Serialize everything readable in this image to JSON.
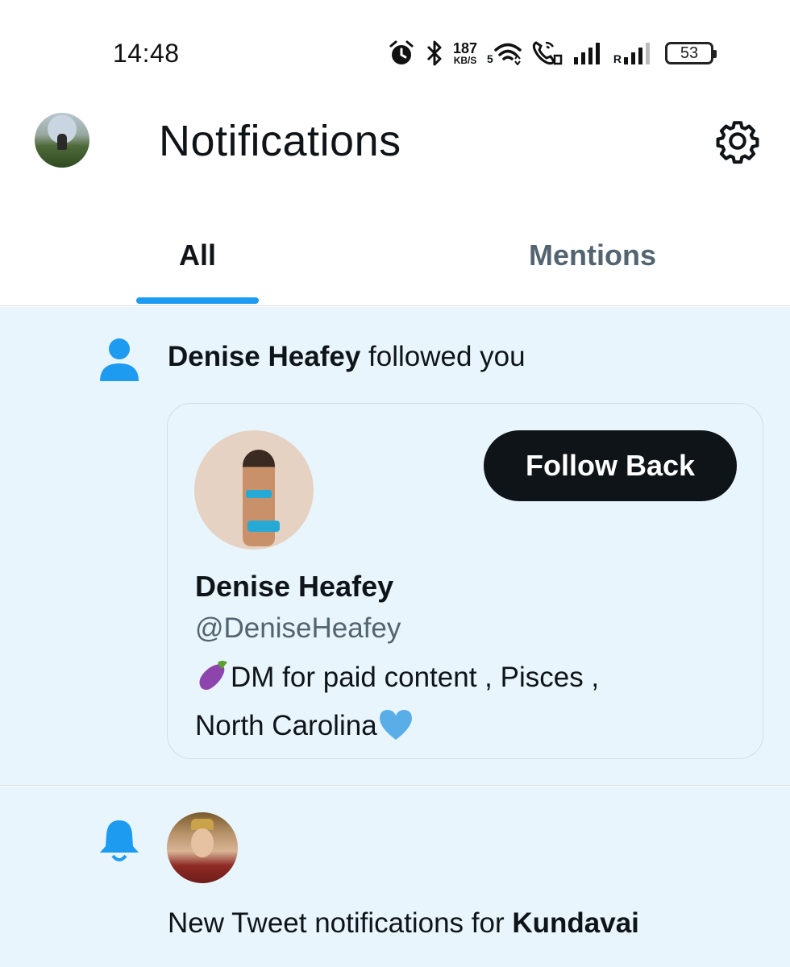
{
  "status_bar": {
    "time": "14:48",
    "net_speed_value": "187",
    "net_speed_unit": "KB/S",
    "wifi_label": "5",
    "roaming_label": "R",
    "battery": "53",
    "icons": [
      "alarm-icon",
      "bluetooth-icon",
      "wifi-icon",
      "volte-call-icon",
      "signal-icon",
      "signal-roaming-icon",
      "battery-icon"
    ]
  },
  "header": {
    "title": "Notifications",
    "settings_icon": "gear-icon"
  },
  "tabs": [
    {
      "label": "All",
      "selected": true
    },
    {
      "label": "Mentions",
      "selected": false
    }
  ],
  "accent_color": "#1d9bf0",
  "notifications": [
    {
      "type": "follow",
      "icon": "person-icon",
      "actor": "Denise Heafey",
      "action": "followed you",
      "card": {
        "name": "Denise Heafey",
        "handle": "@DeniseHeafey",
        "bio_line1": "DM for paid content , Pisces ,",
        "bio_line2": "North Carolina",
        "bio_emoji_1": "eggplant-emoji",
        "bio_emoji_2": "blue-heart-emoji",
        "follow_button": "Follow Back"
      }
    },
    {
      "type": "tweet_notification",
      "icon": "bell-icon",
      "prefix": "New Tweet notifications for ",
      "account": "Kundavai"
    }
  ]
}
